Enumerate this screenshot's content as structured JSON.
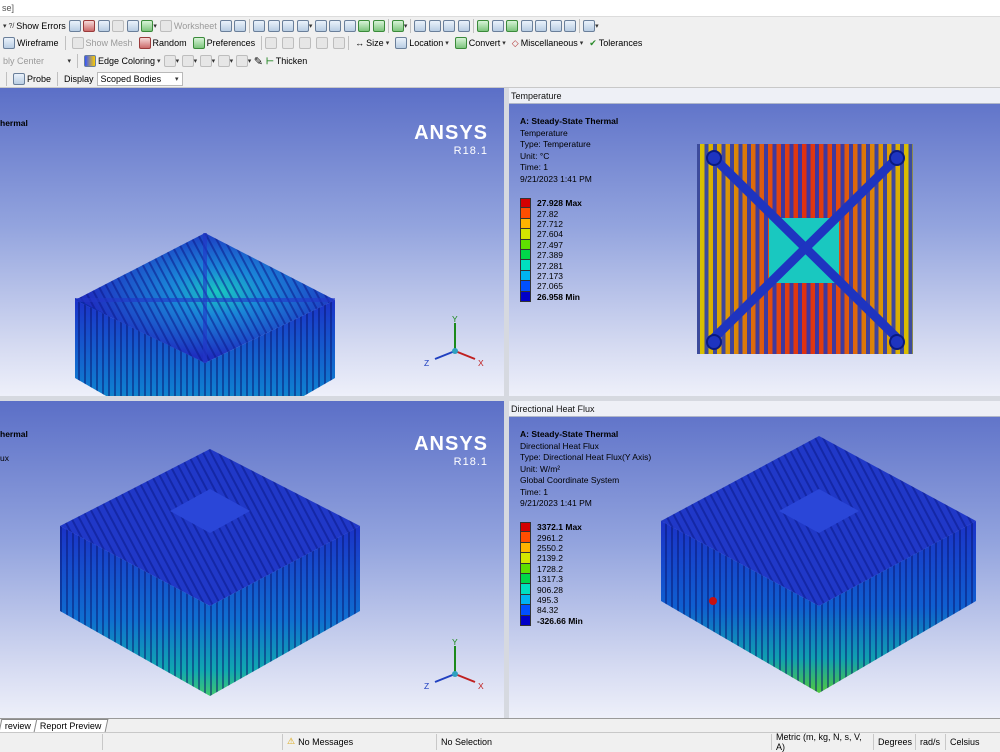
{
  "titlebar": {
    "text": "se]"
  },
  "toolbar1": {
    "show_errors": "Show Errors",
    "worksheet": "Worksheet"
  },
  "toolbar2": {
    "wireframe": "Wireframe",
    "show_mesh": "Show Mesh",
    "random": "Random",
    "preferences": "Preferences",
    "size": "Size",
    "location": "Location",
    "convert": "Convert",
    "miscellaneous": "Miscellaneous",
    "tolerances": "Tolerances"
  },
  "toolbar3": {
    "assembly_center": "bly Center",
    "edge_coloring": "Edge Coloring",
    "thicken": "Thicken"
  },
  "toolbar4": {
    "probe": "Probe",
    "display_label": "Display",
    "display_value": "Scoped Bodies"
  },
  "viewports": {
    "top_left": {
      "partial_title": "hermal",
      "logo": "ANSYS",
      "version": "R18.1"
    },
    "top_right": {
      "panel_title": "Temperature",
      "info": [
        "A: Steady-State Thermal",
        "Temperature",
        "Type: Temperature",
        "Unit: °C",
        "Time: 1",
        "9/21/2023 1:41 PM"
      ],
      "legend": [
        "27.928 Max",
        "27.82",
        "27.712",
        "27.604",
        "27.497",
        "27.389",
        "27.281",
        "27.173",
        "27.065",
        "26.958 Min"
      ]
    },
    "bottom_left": {
      "partial_title": "hermal",
      "partial_line": "ux",
      "logo": "ANSYS",
      "version": "R18.1"
    },
    "bottom_right": {
      "panel_title": "Directional Heat Flux",
      "info": [
        "A: Steady-State Thermal",
        "Directional Heat Flux",
        "Type: Directional Heat Flux(Y Axis)",
        "Unit: W/m²",
        "Global Coordinate System",
        "Time: 1",
        "9/21/2023 1:41 PM"
      ],
      "legend": [
        "3372.1 Max",
        "2961.2",
        "2550.2",
        "2139.2",
        "1728.2",
        "1317.3",
        "906.28",
        "495.3",
        "84.32",
        "-326.66 Min"
      ]
    }
  },
  "legend_colors": [
    "#d40000",
    "#ff4e00",
    "#ffb400",
    "#d5e600",
    "#5fe000",
    "#00d84a",
    "#00e0c0",
    "#00b4f0",
    "#0050ff",
    "#0000c8"
  ],
  "axes": {
    "x": "X",
    "y": "Y",
    "z": "Z"
  },
  "tabs": [
    "review",
    "Report Preview"
  ],
  "status": {
    "messages": "No Messages",
    "selection": "No Selection",
    "units": "Metric (m, kg, N, s, V, A)",
    "angle": "Degrees",
    "rate": "rad/s",
    "temperature": "Celsius"
  }
}
